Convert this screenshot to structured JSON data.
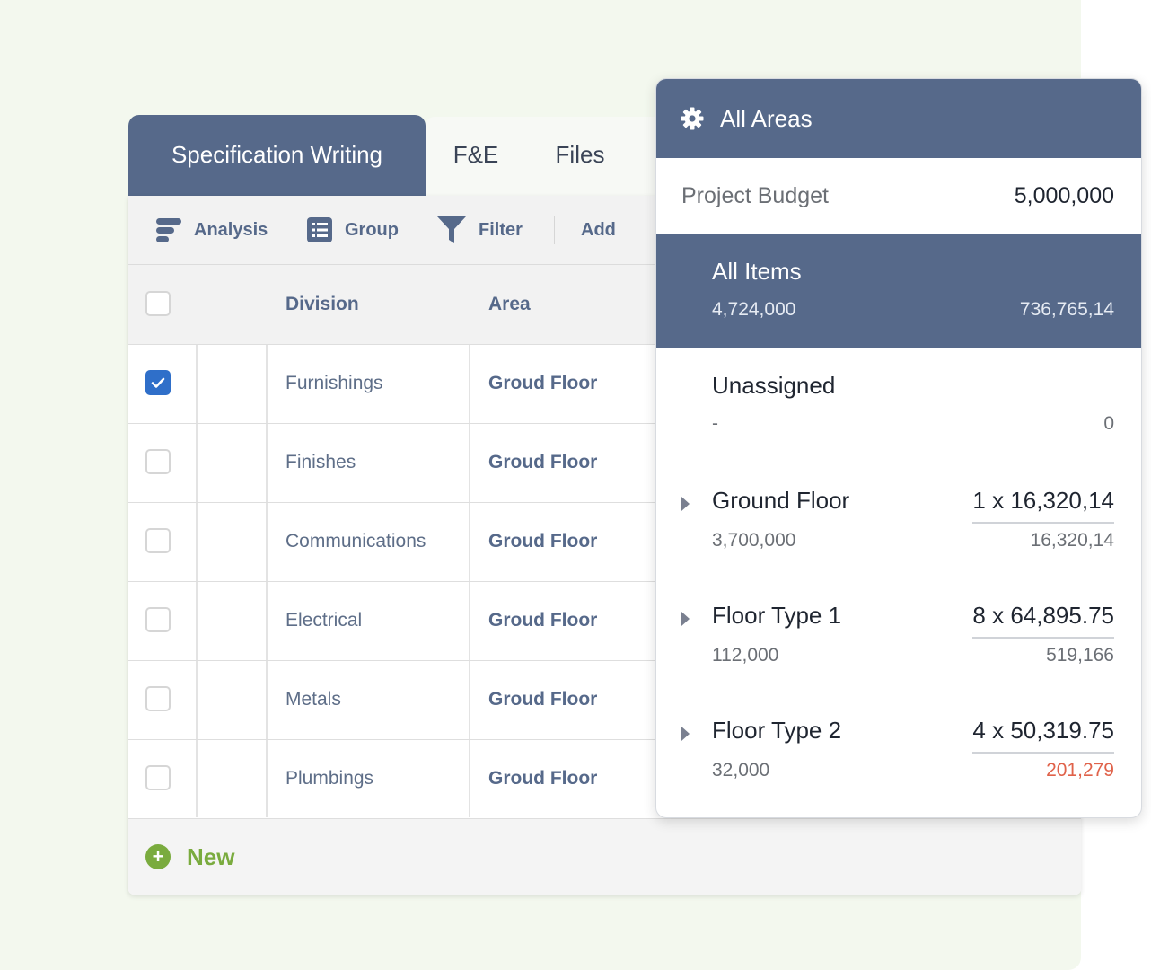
{
  "tabs": [
    {
      "label": "Specification Writing",
      "active": true
    },
    {
      "label": "F&E",
      "active": false
    },
    {
      "label": "Files",
      "active": false
    }
  ],
  "toolbar": {
    "analysis": "Analysis",
    "group": "Group",
    "filter": "Filter",
    "add": "Add"
  },
  "table": {
    "headers": {
      "division": "Division",
      "area": "Area"
    },
    "rows": [
      {
        "division": "Furnishings",
        "area": "Groud Floor",
        "checked": true
      },
      {
        "division": "Finishes",
        "area": "Groud Floor",
        "checked": false
      },
      {
        "division": "Communications",
        "area": "Groud Floor",
        "checked": false
      },
      {
        "division": "Electrical",
        "area": "Groud Floor",
        "checked": false
      },
      {
        "division": "Metals",
        "area": "Groud Floor",
        "checked": false
      },
      {
        "division": "Plumbings",
        "area": "Groud Floor",
        "checked": false
      }
    ]
  },
  "footer": {
    "new_label": "New"
  },
  "panel": {
    "title": "All Areas",
    "budget": {
      "label": "Project Budget",
      "value": "5,000,000"
    },
    "all_items": {
      "name": "All Items",
      "left": "4,724,000",
      "right": "736,765,14"
    },
    "unassigned": {
      "name": "Unassigned",
      "left": "-",
      "right": "0"
    },
    "areas": [
      {
        "name": "Ground Floor",
        "qty": "1 x 16,320,14",
        "left": "3,700,000",
        "right": "16,320,14"
      },
      {
        "name": "Floor Type 1",
        "qty": "8 x 64,895.75",
        "left": "112,000",
        "right": "519,166"
      },
      {
        "name": "Floor Type 2",
        "qty": "4 x 50,319.75",
        "left": "32,000",
        "right": "201,279"
      }
    ]
  },
  "colors": {
    "accent": "#56698a",
    "checkbox_checked": "#2f6fc9",
    "new_green": "#7aab3e",
    "over_budget": "#e0624a"
  }
}
